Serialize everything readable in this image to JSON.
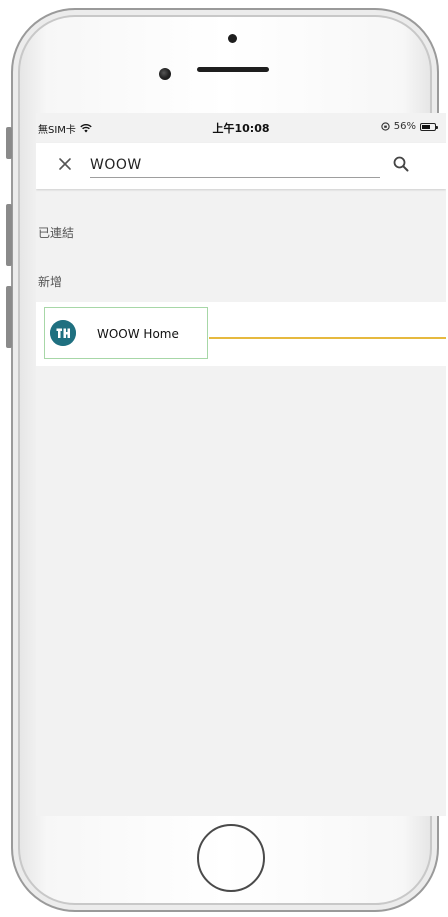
{
  "status_bar": {
    "carrier": "無SIM卡",
    "time": "上午10:08",
    "battery_percent": "56%",
    "battery_level": 0.56
  },
  "search": {
    "value": "WOOW",
    "placeholder": ""
  },
  "sections": {
    "connected_label": "已連結",
    "new_label": "新增"
  },
  "results": [
    {
      "name": "WOOW Home",
      "icon": "woow-home-logo"
    }
  ],
  "colors": {
    "highlight_border": "#a7d7a7",
    "callout_line": "#e6b93f",
    "logo_bg": "#1f7080",
    "screen_bg": "#f2f2f2"
  }
}
